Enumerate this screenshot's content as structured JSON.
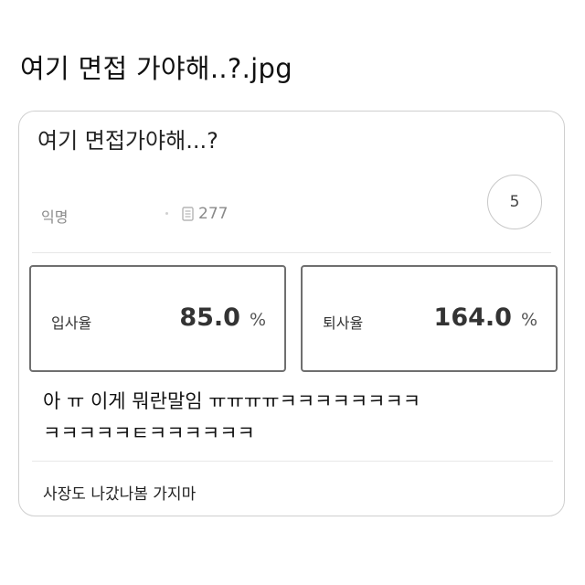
{
  "headline": "여기 면접 가야해..?.jpg",
  "post": {
    "title": "여기 면접가야해...?",
    "author": "익명",
    "views": "277",
    "count": "5",
    "icons": {
      "views": "document-icon"
    }
  },
  "stats": {
    "hire": {
      "label": "입사율",
      "value": "85.0",
      "unit": "%"
    },
    "quit": {
      "label": "퇴사율",
      "value": "164.0",
      "unit": "%"
    }
  },
  "comment": {
    "line1": "아  ㅠ 이게 뭐란말임 ㅠㅠㅠㅠㅋㅋㅋㅋㅋㅋㅋㅋ",
    "line2": "ㅋㅋㅋㅋㅋㅌㅋㅋㅋㅋㅋㅋ"
  },
  "reply": "사장도 나갔나봄 가지마"
}
